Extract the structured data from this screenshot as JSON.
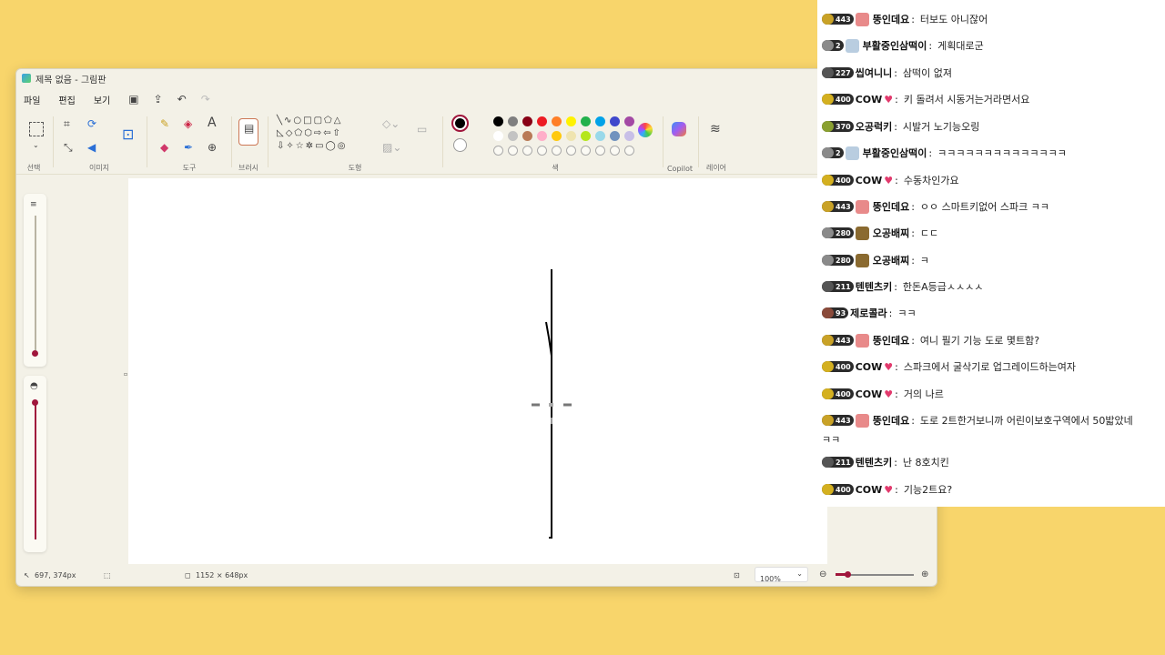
{
  "window": {
    "title": "제목 없음 - 그림판"
  },
  "menu": {
    "file": "파일",
    "edit": "편집",
    "view": "보기"
  },
  "ribbon": {
    "select_label": "선택",
    "image_label": "이미지",
    "tools_label": "도구",
    "brush_label": "브러시",
    "shapes_label": "도형",
    "colors_label": "색",
    "copilot_label": "Copilot",
    "layers_label": "레이어",
    "text_tool": "A"
  },
  "colors": {
    "current_primary": "#000000",
    "current_secondary": "#ffffff",
    "row1": [
      "#000000",
      "#7f7f7f",
      "#880015",
      "#ed1c24",
      "#ff7f27",
      "#fff200",
      "#22b14c",
      "#00a2e8",
      "#3f48cc",
      "#a349a4"
    ],
    "row2": [
      "#ffffff",
      "#c3c3c3",
      "#b97a57",
      "#ffaec9",
      "#ffc90e",
      "#efe4b0",
      "#b5e61d",
      "#99d9ea",
      "#7092be",
      "#c8bfe7"
    ]
  },
  "status": {
    "cursor_pos": "697, 374px",
    "canvas_size": "1152 × 648px",
    "zoom": "100%"
  },
  "chat": {
    "messages": [
      {
        "badge": "443",
        "nick": "뚱인데요",
        "heart": false,
        "msg": "터보도 아니잖어",
        "avatar": "#e88a8a",
        "medal": "#c9a227"
      },
      {
        "badge": "2",
        "nick": "부활중인삼떡이",
        "heart": false,
        "msg": "게획대로군",
        "avatar": "#b9cde0",
        "medal": "#8a8a8a"
      },
      {
        "badge": "227",
        "nick": "씹여니니",
        "heart": false,
        "msg": "삼떡이 없져",
        "avatar": "",
        "medal": "#555555"
      },
      {
        "badge": "400",
        "nick": "COW",
        "heart": true,
        "msg": "키 돌려서 시동거는거라면서요",
        "avatar": "",
        "medal": "#d4b020"
      },
      {
        "badge": "370",
        "nick": "오공럭키",
        "heart": false,
        "msg": "시발거 노기능오링",
        "avatar": "",
        "medal": "#8aa030"
      },
      {
        "badge": "2",
        "nick": "부활중인삼떡이",
        "heart": false,
        "msg": "ㅋㅋㅋㅋㅋㅋㅋㅋㅋㅋㅋㅋㅋㅋ",
        "avatar": "#b9cde0",
        "medal": "#8a8a8a"
      },
      {
        "badge": "400",
        "nick": "COW",
        "heart": true,
        "msg": "수동차인가요",
        "avatar": "",
        "medal": "#d4b020"
      },
      {
        "badge": "443",
        "nick": "뚱인데요",
        "heart": false,
        "msg": "ㅇㅇ 스마트키없어 스파크 ㅋㅋ",
        "avatar": "#e88a8a",
        "medal": "#c9a227"
      },
      {
        "badge": "280",
        "nick": "오공배찌",
        "heart": false,
        "msg": "ㄷㄷ",
        "avatar": "#8a6a30",
        "medal": "#8a8a8a"
      },
      {
        "badge": "280",
        "nick": "오공배찌",
        "heart": false,
        "msg": "ㅋ",
        "avatar": "#8a6a30",
        "medal": "#8a8a8a"
      },
      {
        "badge": "211",
        "nick": "텐텐츠키",
        "heart": false,
        "msg": "한돈A등급ㅅㅅㅅㅅ",
        "avatar": "",
        "medal": "#555555"
      },
      {
        "badge": "93",
        "nick": "제로콜라",
        "heart": false,
        "msg": "ㅋㅋ",
        "avatar": "",
        "medal": "#8a4a3a"
      },
      {
        "badge": "443",
        "nick": "뚱인데요",
        "heart": false,
        "msg": "여니 필기 기능 도로 몇트함?",
        "avatar": "#e88a8a",
        "medal": "#c9a227"
      },
      {
        "badge": "400",
        "nick": "COW",
        "heart": true,
        "msg": "스파크에서 굴삭기로 업그레이드하는여자",
        "avatar": "",
        "medal": "#d4b020"
      },
      {
        "badge": "400",
        "nick": "COW",
        "heart": true,
        "msg": "거의 나르",
        "avatar": "",
        "medal": "#d4b020"
      },
      {
        "badge": "443",
        "nick": "뚱인데요",
        "heart": false,
        "msg": "도로 2트한거보니까 어린이보호구역에서 50밟았네",
        "avatar": "#e88a8a",
        "medal": "#c9a227"
      },
      {
        "badge": "211",
        "nick": "텐텐츠키",
        "heart": false,
        "msg": "난 8호치킨",
        "avatar": "",
        "medal": "#555555"
      },
      {
        "badge": "400",
        "nick": "COW",
        "heart": true,
        "msg": "기능2트요?",
        "avatar": "",
        "medal": "#d4b020"
      }
    ],
    "wrap_text": "ㅋㅋ"
  }
}
